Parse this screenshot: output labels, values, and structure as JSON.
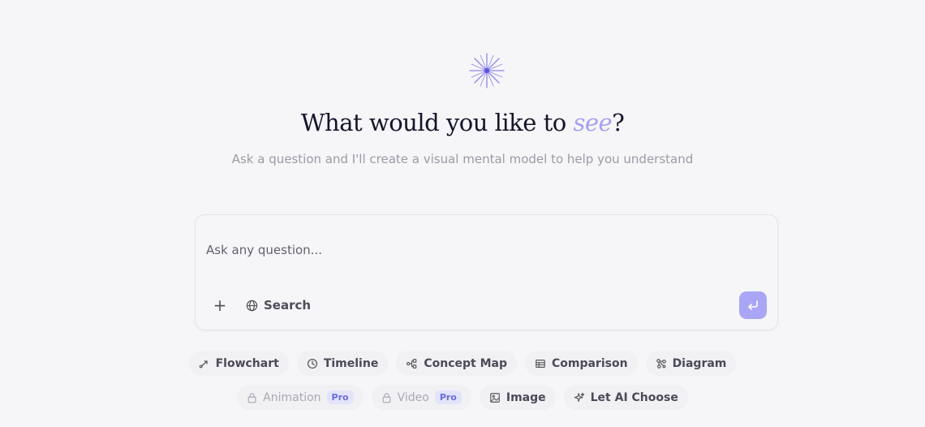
{
  "header": {
    "title_prefix": "What would you like to ",
    "title_accent": "see",
    "title_suffix": "?",
    "subtitle": "Ask a question and I'll create a visual mental model to help you understand"
  },
  "composer": {
    "placeholder": "Ask any question...",
    "value": "",
    "add_label": "+",
    "search_label": "Search"
  },
  "chips_row1": [
    {
      "label": "Flowchart",
      "icon": "flowchart-icon"
    },
    {
      "label": "Timeline",
      "icon": "clock-icon"
    },
    {
      "label": "Concept Map",
      "icon": "concept-map-icon"
    },
    {
      "label": "Comparison",
      "icon": "table-icon"
    },
    {
      "label": "Diagram",
      "icon": "diagram-icon"
    }
  ],
  "chips_row2": [
    {
      "label": "Animation",
      "icon": "lock-icon",
      "badge": "Pro",
      "locked": true
    },
    {
      "label": "Video",
      "icon": "lock-icon",
      "badge": "Pro",
      "locked": true
    },
    {
      "label": "Image",
      "icon": "image-icon",
      "locked": false
    },
    {
      "label": "Let AI Choose",
      "icon": "sparkles-icon",
      "locked": false
    }
  ],
  "colors": {
    "accent": "#a5a0f3",
    "submit": "#a9a6f5",
    "background": "#f6f6f8",
    "pro_badge": "#6a6cde"
  }
}
